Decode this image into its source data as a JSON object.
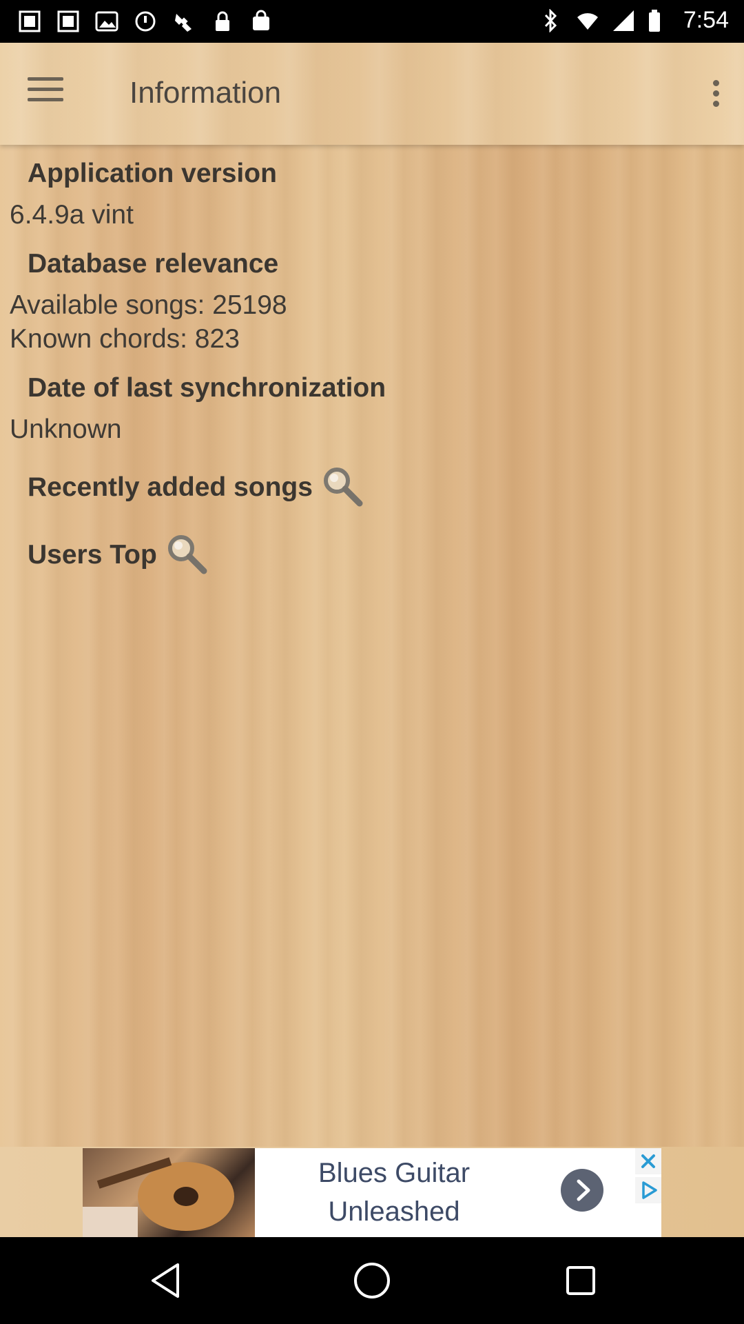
{
  "status_bar": {
    "time": "7:54"
  },
  "app_bar": {
    "title": "Information",
    "menu_icon": "hamburger-menu-icon",
    "overflow_icon": "more-vertical-icon"
  },
  "sections": {
    "app_version": {
      "heading": "Application version",
      "value": "6.4.9a vint"
    },
    "database": {
      "heading": "Database relevance",
      "songs": "Available songs: 25198",
      "chords": "Known chords: 823"
    },
    "sync": {
      "heading": "Date of last synchronization",
      "value": "Unknown"
    },
    "recent": {
      "heading": "Recently added songs",
      "icon": "search-icon"
    },
    "users_top": {
      "heading": "Users Top",
      "icon": "search-icon"
    }
  },
  "ad": {
    "line1": "Blues Guitar",
    "line2": "Unleashed"
  },
  "colors": {
    "wood_light": "#e8c79a",
    "wood_dark": "#d9ae7e",
    "text": "#3b3630"
  }
}
